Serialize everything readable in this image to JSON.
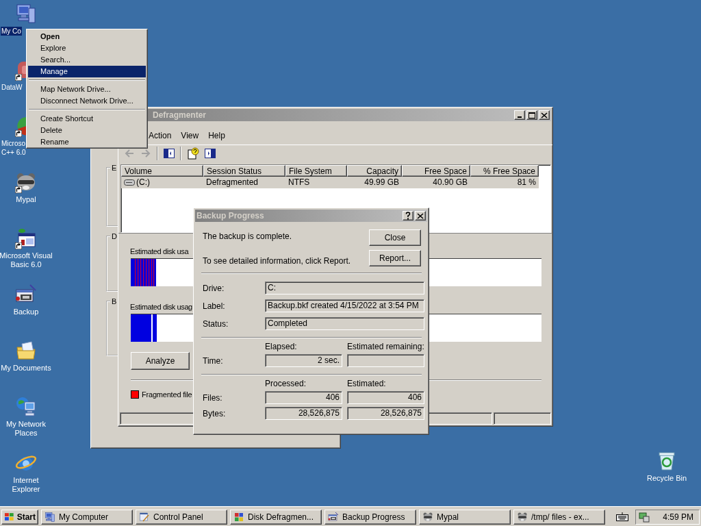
{
  "desktop_icons": [
    {
      "kind": "computer",
      "lines": [
        "My Co"
      ],
      "selected": true,
      "shortcut": false
    },
    {
      "kind": "app",
      "lines": [
        "DataW"
      ],
      "selected": false,
      "shortcut": true
    },
    {
      "kind": "studio",
      "lines": [
        "Microso",
        "C++ 6.0"
      ],
      "selected": false,
      "shortcut": true
    },
    {
      "kind": "raccoon",
      "lines": [
        "Mypal"
      ],
      "selected": false,
      "shortcut": true
    },
    {
      "kind": "vb",
      "lines": [
        "Microsoft Visual",
        "Basic 6.0"
      ],
      "selected": false,
      "shortcut": true
    },
    {
      "kind": "backup",
      "lines": [
        "Backup"
      ],
      "selected": false,
      "shortcut": false
    },
    {
      "kind": "documents",
      "lines": [
        "My Documents"
      ],
      "selected": false,
      "shortcut": false
    },
    {
      "kind": "network",
      "lines": [
        "My Network",
        "Places"
      ],
      "selected": false,
      "shortcut": false
    },
    {
      "kind": "browser",
      "lines": [
        "Internet",
        "Explorer"
      ],
      "selected": false,
      "shortcut": false
    }
  ],
  "recycle_bin": {
    "kind": "recycle",
    "lines": [
      "Recycle Bin"
    ],
    "selected": false,
    "shortcut": false
  },
  "context_menu": {
    "groups": [
      [
        {
          "label": "Open",
          "default": true,
          "selected": false
        },
        {
          "label": "Explore",
          "default": false,
          "selected": false
        },
        {
          "label": "Search...",
          "default": false,
          "selected": false
        },
        {
          "label": "Manage",
          "default": false,
          "selected": true
        }
      ],
      [
        {
          "label": "Map Network Drive...",
          "default": false,
          "selected": false
        },
        {
          "label": "Disconnect Network Drive...",
          "default": false,
          "selected": false
        }
      ],
      [
        {
          "label": "Create Shortcut",
          "default": false,
          "selected": false
        },
        {
          "label": "Delete",
          "default": false,
          "selected": false
        },
        {
          "label": "Rename",
          "default": false,
          "selected": false
        }
      ]
    ]
  },
  "back_window": {
    "group_labels": [
      "E",
      "D",
      "B"
    ]
  },
  "defrag_window": {
    "title": "Defragmenter",
    "menus": [
      "Action",
      "View",
      "Help"
    ],
    "table": {
      "columns": [
        "Volume",
        "Session Status",
        "File System",
        "Capacity",
        "Free Space",
        "% Free Space"
      ],
      "rows": [
        {
          "cells": [
            "(C:)",
            "Defragmented",
            "NTFS",
            "49.99 GB",
            "40.90 GB",
            "81 %"
          ],
          "selected": true
        }
      ]
    },
    "usage_labels": [
      "Estimated disk usa",
      "Estimated disk usag"
    ],
    "buttons": [
      "Analyze"
    ],
    "legend": [
      {
        "label": "Fragmented file",
        "color": "#ff0000"
      }
    ]
  },
  "backup_dialog": {
    "title": "Backup Progress",
    "messages": [
      "The backup is complete.",
      "To see detailed information, click Report."
    ],
    "buttons": [
      "Close",
      "Report..."
    ],
    "fields": [
      {
        "label": "Drive:",
        "value": "C:"
      },
      {
        "label": "Label:",
        "value": "Backup.bkf created 4/15/2022 at 3:54 PM"
      },
      {
        "label": "Status:",
        "value": "Completed"
      }
    ],
    "time": {
      "label": "Time:",
      "headers": [
        "Elapsed:",
        "Estimated remaining:"
      ],
      "values": [
        "2 sec."
      ]
    },
    "counts": {
      "headers": [
        "Processed:",
        "Estimated:"
      ],
      "rows": [
        {
          "label": "Files:",
          "values": [
            "406",
            "406"
          ]
        },
        {
          "label": "Bytes:",
          "values": [
            "28,526,875",
            "28,526,875"
          ]
        }
      ]
    }
  },
  "taskbar": {
    "start": "Start",
    "tasks": [
      {
        "kind": "computer",
        "label": "My Computer"
      },
      {
        "kind": "control",
        "label": "Control Panel"
      },
      {
        "kind": "defrag",
        "label": "Disk Defragmen..."
      },
      {
        "kind": "backup",
        "label": "Backup Progress"
      },
      {
        "kind": "raccoon",
        "label": "Mypal"
      },
      {
        "kind": "raccoon",
        "label": "/tmp/ files - ex..."
      }
    ],
    "clock": "4:59 PM"
  }
}
